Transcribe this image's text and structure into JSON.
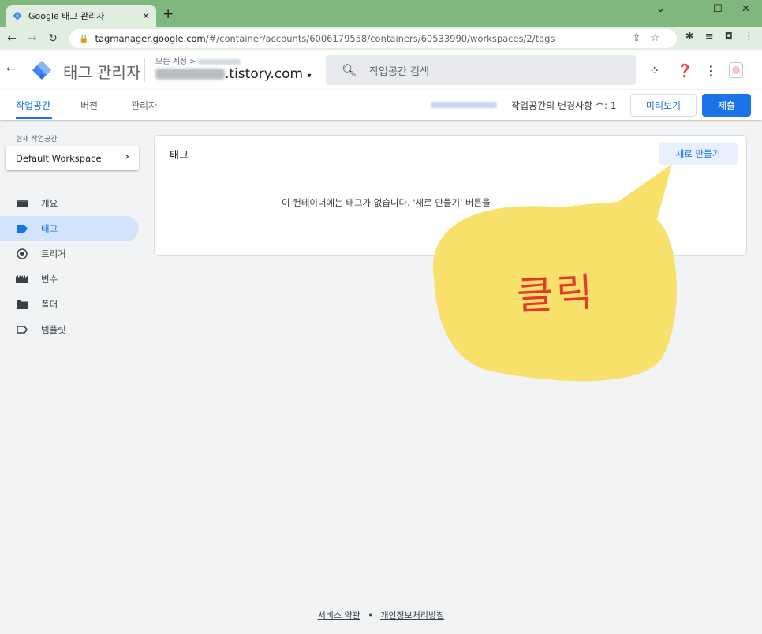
{
  "browser": {
    "tab_title": "Google 태그 관리자",
    "tab_close": "×",
    "new_tab": "+",
    "url_host": "tagmanager.google.com",
    "url_path": "/#/container/accounts/6006179558/containers/60533990/workspaces/2/tags",
    "window_controls": [
      "⌄",
      "—",
      "☐",
      "✕"
    ]
  },
  "header": {
    "app_title": "태그 관리자",
    "account_label": "모든 계정 >",
    "container_name": ".tistory.com",
    "search_placeholder": "작업공간 검색"
  },
  "subnav": {
    "tabs": [
      "작업공간",
      "버전",
      "관리자"
    ],
    "changes_text": "작업공간의 변경사항 수: 1",
    "preview_label": "미리보기",
    "submit_label": "제출"
  },
  "sidebar": {
    "workspace_label": "현재 작업공간",
    "workspace_name": "Default Workspace",
    "items": [
      {
        "label": "개요",
        "icon": "overview-icon"
      },
      {
        "label": "태그",
        "icon": "tag-icon"
      },
      {
        "label": "트리거",
        "icon": "trigger-icon"
      },
      {
        "label": "변수",
        "icon": "variable-icon"
      },
      {
        "label": "폴더",
        "icon": "folder-icon"
      },
      {
        "label": "템플릿",
        "icon": "template-icon"
      }
    ]
  },
  "main": {
    "card_title": "태그",
    "new_button": "새로 만들기",
    "empty_message": "이 컨테이너에는 태그가 없습니다. '새로 만들기' 버튼을"
  },
  "annotation": {
    "bubble_text": "클릭",
    "bubble_color": "#f7e16b",
    "text_color": "#e8382a"
  },
  "footer": {
    "terms": "서비스 약관",
    "separator": "•",
    "privacy": "개인정보처리방침"
  },
  "colors": {
    "accent": "#1a73e8",
    "active_nav_bg": "#d2e3fc",
    "browser_frame": "#7fb77e"
  }
}
